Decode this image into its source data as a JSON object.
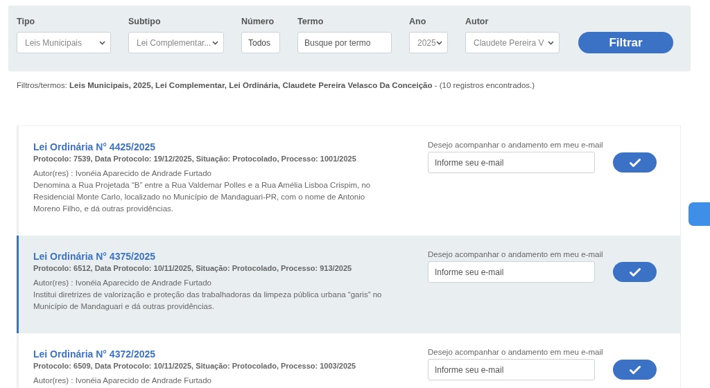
{
  "filters": [
    {
      "kind": "select",
      "label": "Tipo",
      "value": "Leis Municipais"
    },
    {
      "kind": "select",
      "label": "Subtipo",
      "value": "Lei Complementar..."
    },
    {
      "kind": "input",
      "label": "Número",
      "value": "Todos"
    },
    {
      "kind": "input",
      "label": "Termo",
      "placeholder": "Busque por termo"
    },
    {
      "kind": "select",
      "label": "Ano",
      "value": "2025"
    },
    {
      "kind": "select",
      "label": "Autor",
      "value": "Claudete Pereira V"
    }
  ],
  "filter_button": "Filtrar",
  "summary": "Filtros/termos: **Leis Municipais, 2025, Lei Complementar, Lei Ordinária, Claudete Pereira Velasco Da Conceição** - (10 registros encontrados.)",
  "results": [
    {
      "title": "Lei Ordinária N° 4425/2025",
      "meta": "Protocolo: 7539, Data Protocolo: 19/12/2025, Situação: Protocolado, Processo: 1001/2025",
      "author": "Autor(res) : Ivonéia Aparecido de Andrade Furtado",
      "description": "Denomina a Rua Projetada “B” entre a Rua Valdemar Polles e a Rua Amélia Lisboa Crispim, no Residencial Monte Carlo, localizado no Município de Mandaguari-PR, com o nome de Antonio Moreno Filho, e dá outras providências.",
      "email_label": "Desejo acompanhar o andamento em meu e-mail",
      "email_placeholder": "Informe seu e-mail",
      "selected": false
    },
    {
      "title": "Lei Ordinária N° 4375/2025",
      "meta": "Protocolo: 6512, Data Protocolo: 10/11/2025, Situação: Protocolado, Processo: 913/2025",
      "author": "Autor(res) : Ivonéia Aparecido de Andrade Furtado",
      "description": "Institui diretrizes de valorização e proteção das trabalhadoras da limpeza pública urbana “garis” no Município de Mandaguari e dá outras providências.",
      "email_label": "Desejo acompanhar o andamento em meu e-mail",
      "email_placeholder": "Informe seu e-mail",
      "selected": true
    },
    {
      "title": "Lei Ordinária N° 4372/2025",
      "meta": "Protocolo: 6509, Data Protocolo: 10/11/2025, Situação: Protocolado, Processo: 1003/2025",
      "author": "Autor(res) : Ivonéia Aparecido de Andrade Furtado",
      "email_label": "Desejo acompanhar o andamento em meu e-mail",
      "email_placeholder": "Informe seu e-mail",
      "selected": false
    }
  ]
}
